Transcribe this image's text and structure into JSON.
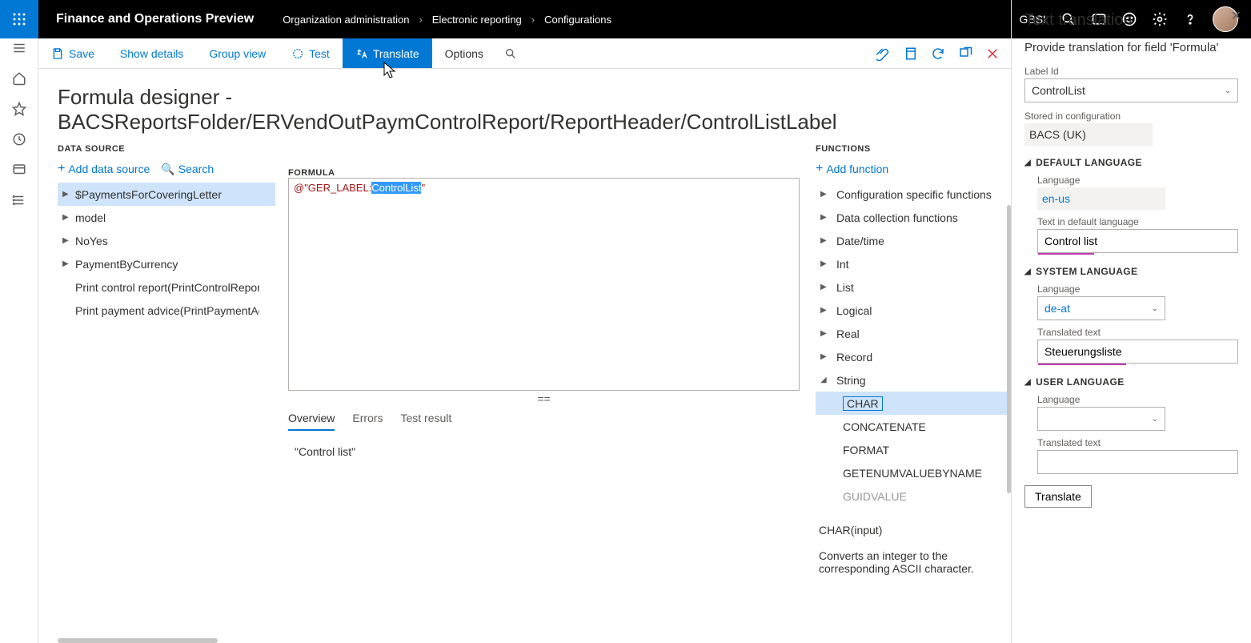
{
  "titlebar": {
    "app_title": "Finance and Operations Preview",
    "breadcrumbs": [
      "Organization administration",
      "Electronic reporting",
      "Configurations"
    ],
    "company": "GBSI"
  },
  "commandbar": {
    "save": "Save",
    "show_details": "Show details",
    "group_view": "Group view",
    "test": "Test",
    "translate": "Translate",
    "options": "Options"
  },
  "page": {
    "heading": "Formula designer - BACSReportsFolder/ERVendOutPaymControlReport/ReportHeader/ControlListLabel"
  },
  "data_source": {
    "label": "DATA SOURCE",
    "add_ds": "Add data source",
    "search": "Search",
    "tree": [
      {
        "name": "$PaymentsForCoveringLetter",
        "exp": true,
        "sel": true
      },
      {
        "name": "model",
        "exp": true
      },
      {
        "name": "NoYes",
        "exp": true
      },
      {
        "name": "PaymentByCurrency",
        "exp": true
      },
      {
        "name": "Print control report(PrintControlReport)",
        "exp": false
      },
      {
        "name": "Print payment advice(PrintPaymentAdvice)",
        "exp": false
      }
    ]
  },
  "formula": {
    "label": "FORMULA",
    "prefix": "@\"GER_LABEL:",
    "selected": "ControlList",
    "suffix": "\""
  },
  "tabs": {
    "overview": "Overview",
    "errors": "Errors",
    "test_result": "Test result",
    "overview_value": "\"Control list\""
  },
  "functions": {
    "label": "FUNCTIONS",
    "add_fn": "Add function",
    "groups": [
      {
        "name": "Configuration specific functions",
        "open": false
      },
      {
        "name": "Data collection functions",
        "open": false
      },
      {
        "name": "Date/time",
        "open": false
      },
      {
        "name": "Int",
        "open": false
      },
      {
        "name": "List",
        "open": false
      },
      {
        "name": "Logical",
        "open": false
      },
      {
        "name": "Real",
        "open": false
      },
      {
        "name": "Record",
        "open": false
      },
      {
        "name": "String",
        "open": true,
        "children": [
          "CHAR",
          "CONCATENATE",
          "FORMAT",
          "GETENUMVALUEBYNAME",
          "GUIDVALUE"
        ]
      }
    ],
    "selected_fn": "CHAR",
    "sig": "CHAR(input)",
    "desc": "Converts an integer to the corresponding ASCII character."
  },
  "side_panel": {
    "title": "Text translation",
    "subtitle": "Provide translation for field 'Formula'",
    "label_id_label": "Label Id",
    "label_id_value": "ControlList",
    "stored_label": "Stored in configuration",
    "stored_value": "BACS (UK)",
    "default_lang_hdr": "DEFAULT LANGUAGE",
    "default_lang_label": "Language",
    "default_lang_value": "en-us",
    "default_text_label": "Text in default language",
    "default_text_value": "Control list",
    "system_lang_hdr": "SYSTEM LANGUAGE",
    "system_lang_label": "Language",
    "system_lang_value": "de-at",
    "translated_label": "Translated text",
    "translated_value": "Steuerungsliste",
    "user_lang_hdr": "USER LANGUAGE",
    "user_lang_label": "Language",
    "user_lang_value": "",
    "user_text_label": "Translated text",
    "user_text_value": "",
    "translate_btn": "Translate"
  }
}
